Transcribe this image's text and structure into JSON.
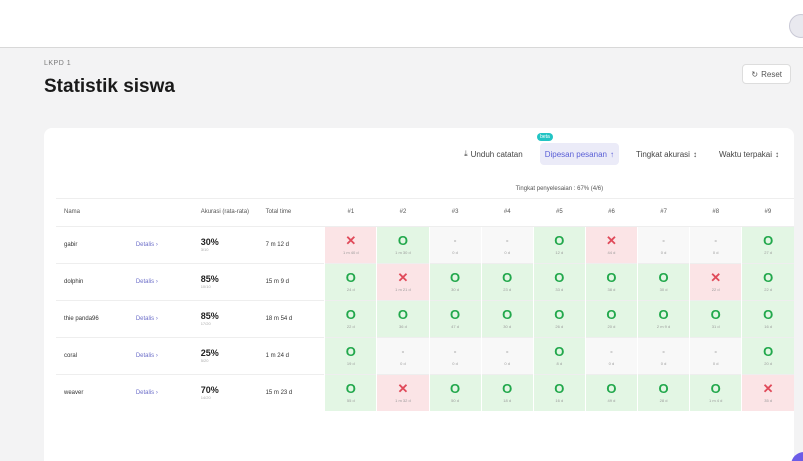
{
  "breadcrumb": "LKPD 1",
  "title": "Statistik siswa",
  "reset_label": "Reset",
  "toolbar": {
    "download_label": "Unduh catatan",
    "beta_badge": "beta",
    "sort_label": "Dipesan pesanan",
    "accuracy_label": "Tingkat akurasi",
    "time_label": "Waktu terpakai"
  },
  "table": {
    "progress_label": "Tingkat penyelesaian : 67% (4/6)",
    "headers": {
      "name": "Nama",
      "accuracy": "Akurasi (rata-rata)",
      "total_time": "Total time",
      "questions": [
        "#1",
        "#2",
        "#3",
        "#4",
        "#5",
        "#6",
        "#7",
        "#8",
        "#9"
      ]
    },
    "detail_label": "Detalis",
    "rows": [
      {
        "name": "gabir",
        "accuracy": "30%",
        "accuracy_sub": "3/10",
        "time": "7 m 12 d",
        "cells": [
          {
            "status": "bad",
            "symbol": "✕",
            "sub": "1 m 40 d"
          },
          {
            "status": "ok",
            "symbol": "O",
            "sub": "1 m 30 d"
          },
          {
            "status": "none",
            "symbol": "-",
            "sub": "0 d"
          },
          {
            "status": "none",
            "symbol": "-",
            "sub": "0 d"
          },
          {
            "status": "ok",
            "symbol": "O",
            "sub": "12 d"
          },
          {
            "status": "bad",
            "symbol": "✕",
            "sub": "44 d"
          },
          {
            "status": "none",
            "symbol": "-",
            "sub": "0 d"
          },
          {
            "status": "none",
            "symbol": "-",
            "sub": "0 d"
          },
          {
            "status": "ok",
            "symbol": "O",
            "sub": "27 d"
          }
        ]
      },
      {
        "name": "dolphin",
        "accuracy": "85%",
        "accuracy_sub": "10/10",
        "time": "15 m 9 d",
        "cells": [
          {
            "status": "ok",
            "symbol": "O",
            "sub": "24 d"
          },
          {
            "status": "bad",
            "symbol": "✕",
            "sub": "1 m 21 d"
          },
          {
            "status": "ok",
            "symbol": "O",
            "sub": "30 d"
          },
          {
            "status": "ok",
            "symbol": "O",
            "sub": "23 d"
          },
          {
            "status": "ok",
            "symbol": "O",
            "sub": "33 d"
          },
          {
            "status": "ok",
            "symbol": "O",
            "sub": "38 d"
          },
          {
            "status": "ok",
            "symbol": "O",
            "sub": "30 d"
          },
          {
            "status": "bad",
            "symbol": "✕",
            "sub": "22 d"
          },
          {
            "status": "ok",
            "symbol": "O",
            "sub": "22 d"
          }
        ]
      },
      {
        "name": "thie panda96",
        "accuracy": "85%",
        "accuracy_sub": "17/20",
        "time": "18 m 54 d",
        "cells": [
          {
            "status": "ok",
            "symbol": "O",
            "sub": "22 d"
          },
          {
            "status": "ok",
            "symbol": "O",
            "sub": "36 d"
          },
          {
            "status": "ok",
            "symbol": "O",
            "sub": "47 d"
          },
          {
            "status": "ok",
            "symbol": "O",
            "sub": "30 d"
          },
          {
            "status": "ok",
            "symbol": "O",
            "sub": "26 d"
          },
          {
            "status": "ok",
            "symbol": "O",
            "sub": "20 d"
          },
          {
            "status": "ok",
            "symbol": "O",
            "sub": "2 m 9 d"
          },
          {
            "status": "ok",
            "symbol": "O",
            "sub": "31 d"
          },
          {
            "status": "ok",
            "symbol": "O",
            "sub": "16 d"
          }
        ]
      },
      {
        "name": "coral",
        "accuracy": "25%",
        "accuracy_sub": "5/20",
        "time": "1 m 24 d",
        "cells": [
          {
            "status": "ok",
            "symbol": "O",
            "sub": "19 d"
          },
          {
            "status": "none",
            "symbol": "-",
            "sub": "0 d"
          },
          {
            "status": "none",
            "symbol": "-",
            "sub": "0 d"
          },
          {
            "status": "none",
            "symbol": "-",
            "sub": "0 d"
          },
          {
            "status": "ok",
            "symbol": "O",
            "sub": "8 d"
          },
          {
            "status": "none",
            "symbol": "-",
            "sub": "0 d"
          },
          {
            "status": "none",
            "symbol": "-",
            "sub": "0 d"
          },
          {
            "status": "none",
            "symbol": "-",
            "sub": "0 d"
          },
          {
            "status": "ok",
            "symbol": "O",
            "sub": "20 d"
          }
        ]
      },
      {
        "name": "weaver",
        "accuracy": "70%",
        "accuracy_sub": "14/20",
        "time": "15 m 23 d",
        "cells": [
          {
            "status": "ok",
            "symbol": "O",
            "sub": "55 d"
          },
          {
            "status": "bad",
            "symbol": "✕",
            "sub": "1 m 32 d"
          },
          {
            "status": "ok",
            "symbol": "O",
            "sub": "50 d"
          },
          {
            "status": "ok",
            "symbol": "O",
            "sub": "18 d"
          },
          {
            "status": "ok",
            "symbol": "O",
            "sub": "16 d"
          },
          {
            "status": "ok",
            "symbol": "O",
            "sub": "49 d"
          },
          {
            "status": "ok",
            "symbol": "O",
            "sub": "28 d"
          },
          {
            "status": "ok",
            "symbol": "O",
            "sub": "1 m 4 d"
          },
          {
            "status": "bad",
            "symbol": "✕",
            "sub": "35 d"
          }
        ]
      }
    ]
  }
}
